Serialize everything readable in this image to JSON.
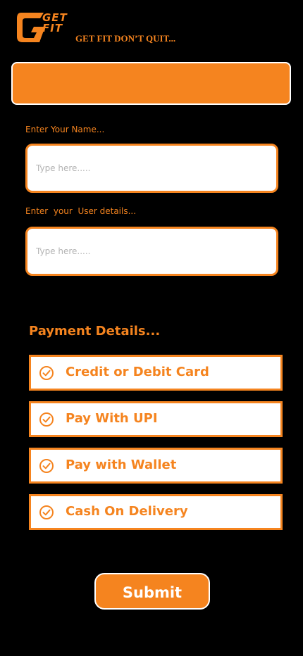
{
  "brand": {
    "logo_line1": "GET",
    "logo_line2": "FIT",
    "tagline": "GET FIT DON’T QUIT...",
    "accent_color": "#f5841f"
  },
  "form": {
    "name_label": "Enter Your Name...",
    "name_placeholder": "Type here.....",
    "details_label": "Enter  your  User details...",
    "details_placeholder": "Type here....."
  },
  "payment": {
    "title": "Payment Details...",
    "options": [
      {
        "label": "Credit or Debit Card",
        "icon": "check-circle-icon"
      },
      {
        "label": "Pay With UPI",
        "icon": "check-circle-icon"
      },
      {
        "label": "Pay with Wallet",
        "icon": "check-circle-icon"
      },
      {
        "label": "Cash On Delivery",
        "icon": "check-circle-icon"
      }
    ]
  },
  "submit_label": "Submit"
}
